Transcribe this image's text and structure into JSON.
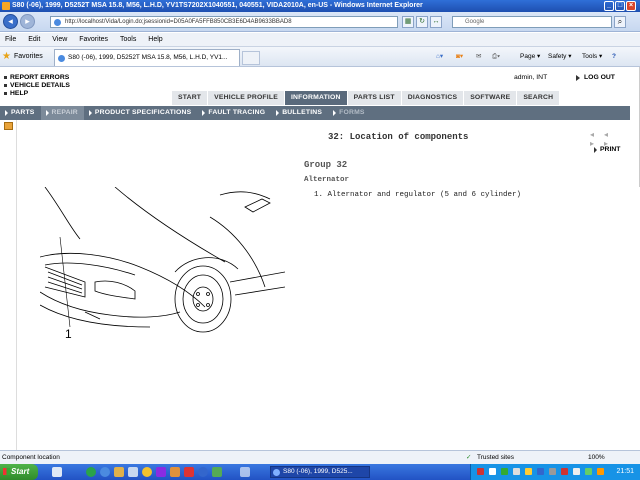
{
  "window": {
    "title": "S80 (-06), 1999, D5252T MSA 15.8, M56, L.H.D, YV1TS7202X1040551, 040551, VIDA2010A, en-US - Windows Internet Explorer",
    "min": "_",
    "max": "□",
    "close": "×"
  },
  "address": {
    "url": "http://localhost/Vida/Login.do;jsessionid=D05A0FA5FFB850CB3E6D4AB9633BBAD8",
    "search_placeholder": "Google"
  },
  "menu": [
    "File",
    "Edit",
    "View",
    "Favorites",
    "Tools",
    "Help"
  ],
  "favorites_bar": {
    "favorites_label": "Favorites",
    "tab_title": "S80 (-06), 1999, D5252T MSA 15.8, M56, L.H.D, YV1...",
    "page_label": "Page ▾",
    "safety_label": "Safety ▾",
    "tools_label": "Tools ▾",
    "help_label": "?"
  },
  "app": {
    "left_links": [
      "REPORT ERRORS",
      "VEHICLE DETAILS",
      "HELP"
    ],
    "user": "admin, INT",
    "logout": "LOG OUT",
    "main_tabs": [
      "START",
      "VEHICLE PROFILE",
      "INFORMATION",
      "PARTS LIST",
      "DIAGNOSTICS",
      "SOFTWARE",
      "SEARCH"
    ],
    "active_main_tab": "INFORMATION",
    "sub_tabs": [
      "PARTS",
      "REPAIR",
      "PRODUCT SPECIFICATIONS",
      "FAULT TRACING",
      "BULLETINS",
      "FORMS"
    ],
    "active_sub_tab": "REPAIR",
    "disabled_sub_tab": "FORMS"
  },
  "content": {
    "page_title": "32: Location of components",
    "nav_arrows": "◂◂ ▸▸",
    "print": "PRINT",
    "group": "Group 32",
    "subheading": "Alternator",
    "items": [
      "1.  Alternator and regulator (5 and 6 cylinder)"
    ],
    "figure_label": "1"
  },
  "status": {
    "left": "Component location",
    "zone": "Trusted sites",
    "zoom": "100%"
  },
  "taskbar": {
    "start": "Start",
    "window_button": "S80 (-06), 1999, D525...",
    "clock": "21:51"
  },
  "colors": {
    "subnav": "#5f6f80",
    "active_tab": "#5a6a7c",
    "titlebar": "#1e4fb0",
    "taskbar": "#2252c4"
  }
}
